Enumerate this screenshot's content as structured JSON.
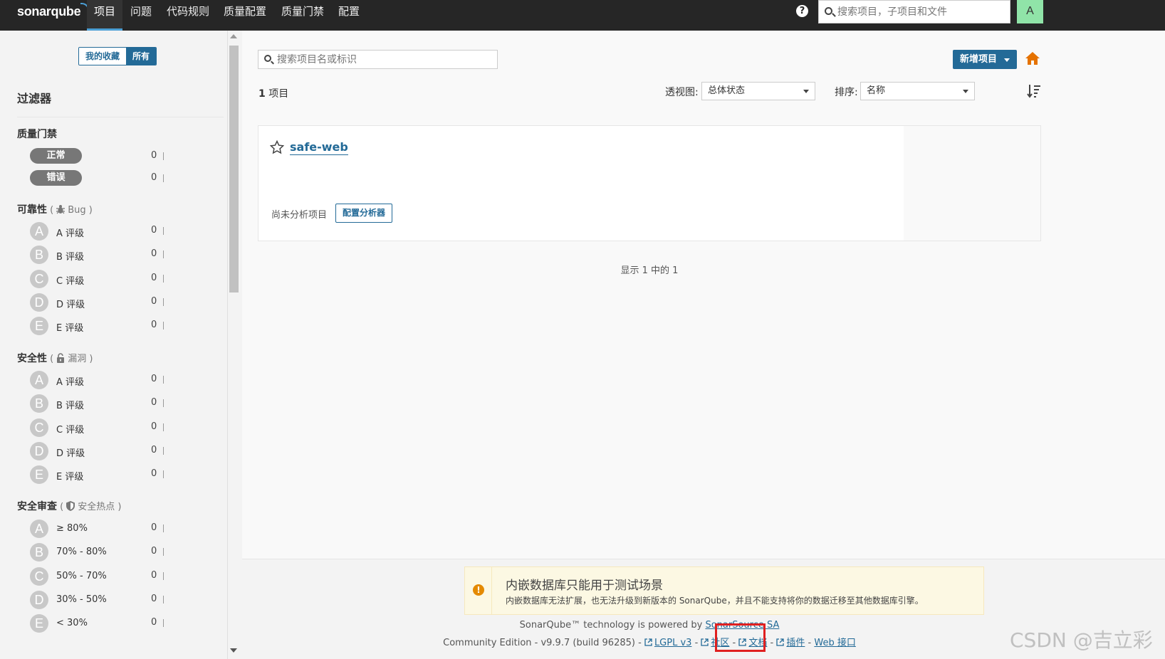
{
  "navbar": {
    "logo": "sonarqube",
    "items": [
      "项目",
      "问题",
      "代码规则",
      "质量配置",
      "质量门禁",
      "配置"
    ],
    "search_placeholder": "搜索项目，子项目和文件",
    "avatar_letter": "A",
    "help_glyph": "?"
  },
  "sidebar": {
    "toggle": {
      "favorites": "我的收藏",
      "all": "所有"
    },
    "filters_title": "过滤器",
    "quality_gate": {
      "title": "质量门禁",
      "items": [
        {
          "label": "正常",
          "count": "0"
        },
        {
          "label": "错误",
          "count": "0"
        }
      ]
    },
    "reliability": {
      "title": "可靠性",
      "sub": "Bug",
      "items": [
        {
          "grade": "A",
          "label": "A 评级",
          "count": "0"
        },
        {
          "grade": "B",
          "label": "B 评级",
          "count": "0"
        },
        {
          "grade": "C",
          "label": "C 评级",
          "count": "0"
        },
        {
          "grade": "D",
          "label": "D 评级",
          "count": "0"
        },
        {
          "grade": "E",
          "label": "E 评级",
          "count": "0"
        }
      ]
    },
    "security": {
      "title": "安全性",
      "sub": "漏洞",
      "items": [
        {
          "grade": "A",
          "label": "A 评级",
          "count": "0"
        },
        {
          "grade": "B",
          "label": "B 评级",
          "count": "0"
        },
        {
          "grade": "C",
          "label": "C 评级",
          "count": "0"
        },
        {
          "grade": "D",
          "label": "D 评级",
          "count": "0"
        },
        {
          "grade": "E",
          "label": "E 评级",
          "count": "0"
        }
      ]
    },
    "security_review": {
      "title": "安全审查",
      "sub": "安全热点",
      "items": [
        {
          "grade": "A",
          "label": "≥ 80%",
          "count": "0"
        },
        {
          "grade": "B",
          "label": "70% - 80%",
          "count": "0"
        },
        {
          "grade": "C",
          "label": "50% - 70%",
          "count": "0"
        },
        {
          "grade": "D",
          "label": "30% - 50%",
          "count": "0"
        },
        {
          "grade": "E",
          "label": "< 30%",
          "count": "0"
        }
      ]
    }
  },
  "main": {
    "search_placeholder": "搜索项目名或标识",
    "new_project": "新增项目",
    "count_number": "1",
    "count_label": "项目",
    "perspective_label": "透视图:",
    "perspective_value": "总体状态",
    "sort_label": "排序:",
    "sort_value": "名称",
    "project": {
      "name": "safe-web",
      "status": "尚未分析项目",
      "config_button": "配置分析器"
    },
    "shown": "显示 1 中的 1"
  },
  "footer": {
    "warning_title": "内嵌数据库只能用于测试场景",
    "warning_text": "内嵌数据库无法扩展，也无法升级到新版本的 SonarQube，并且不能支持将你的数据迁移至其他数据库引擎。",
    "powered_prefix": "SonarQube™ technology is powered by",
    "powered_link": "SonarSource SA",
    "edition": "Community Edition - v9.9.7 (build 96285) -",
    "links": [
      "LGPL v3",
      "社区",
      "文档",
      "插件",
      "Web 接口"
    ]
  },
  "watermark": "CSDN @吉立彩",
  "colors": {
    "brand_blue": "#236a97",
    "navbar": "#262626",
    "home_icon": "#e57200",
    "warning_dot": "#e48a00",
    "highlight": "#e02020"
  },
  "icons": [
    "search-icon",
    "help-icon",
    "home-icon",
    "sort-icon",
    "star-icon",
    "bug-icon",
    "lock-icon",
    "shield-icon",
    "external-link-icon",
    "warning-icon"
  ]
}
